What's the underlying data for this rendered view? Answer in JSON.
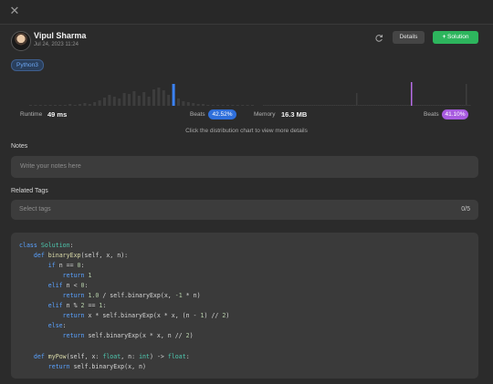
{
  "header": {
    "close_icon": "close-icon",
    "user_name": "Vipul Sharma",
    "date": "Jul 24, 2023 11:24",
    "refresh_icon": "refresh-icon",
    "details_label": "Details",
    "solution_label": "Solution",
    "solution_icon": "+"
  },
  "language": "Python3",
  "distribution": {
    "runtime_label": "Runtime",
    "runtime_value": "49 ms",
    "runtime_beats_label": "Beats",
    "runtime_beats_value": "42.52%",
    "memory_label": "Memory",
    "memory_value": "16.3 MB",
    "memory_beats_label": "Beats",
    "memory_beats_value": "41.10%",
    "hint": "Click the distribution chart to view more details",
    "colors": {
      "bar": "#3d3d3d",
      "runtime_highlight": "#3b82f6",
      "memory_highlight": "#b56ce6"
    }
  },
  "notes": {
    "label": "Notes",
    "placeholder": "Write your notes here"
  },
  "tags": {
    "label": "Related Tags",
    "placeholder": "Select tags",
    "count": "0/5"
  },
  "code": {
    "l1_kw": "class",
    "l1_name": "Solution",
    "l1_rest": ":",
    "l2_kw": "def",
    "l2_fn": "binaryExp",
    "l2_rest": "(self, x, n):",
    "l3_kw": "if",
    "l3_rest": " n == ",
    "l3_num": "0",
    "l3_end": ":",
    "l4_kw": "return",
    "l4_num": "1",
    "l5_kw": "elif",
    "l5_rest": " n < ",
    "l5_num": "0",
    "l5_end": ":",
    "l6_kw": "return",
    "l6_num": "1.0",
    "l6_rest": " / self.binaryExp(x, ",
    "l6_num2": "-1",
    "l6_end": " * n)",
    "l7_kw": "elif",
    "l7_rest": " n % ",
    "l7_num": "2",
    "l7_mid": " == ",
    "l7_num2": "1",
    "l7_end": ":",
    "l8_kw": "return",
    "l8_rest": " x * self.binaryExp(x * x, (n - ",
    "l8_num": "1",
    "l8_mid": ") // ",
    "l8_num2": "2",
    "l8_end": ")",
    "l9_kw": "else",
    "l9_end": ":",
    "l10_kw": "return",
    "l10_rest": " self.binaryExp(x * x, n // ",
    "l10_num": "2",
    "l10_end": ")",
    "l12_kw": "def",
    "l12_fn": "myPow",
    "l12_a": "(self, x: ",
    "l12_t1": "float",
    "l12_b": ", n: ",
    "l12_t2": "int",
    "l12_c": ") -> ",
    "l12_t3": "float",
    "l12_d": ":",
    "l13_kw": "return",
    "l13_rest": " self.binaryExp(x, n)"
  }
}
